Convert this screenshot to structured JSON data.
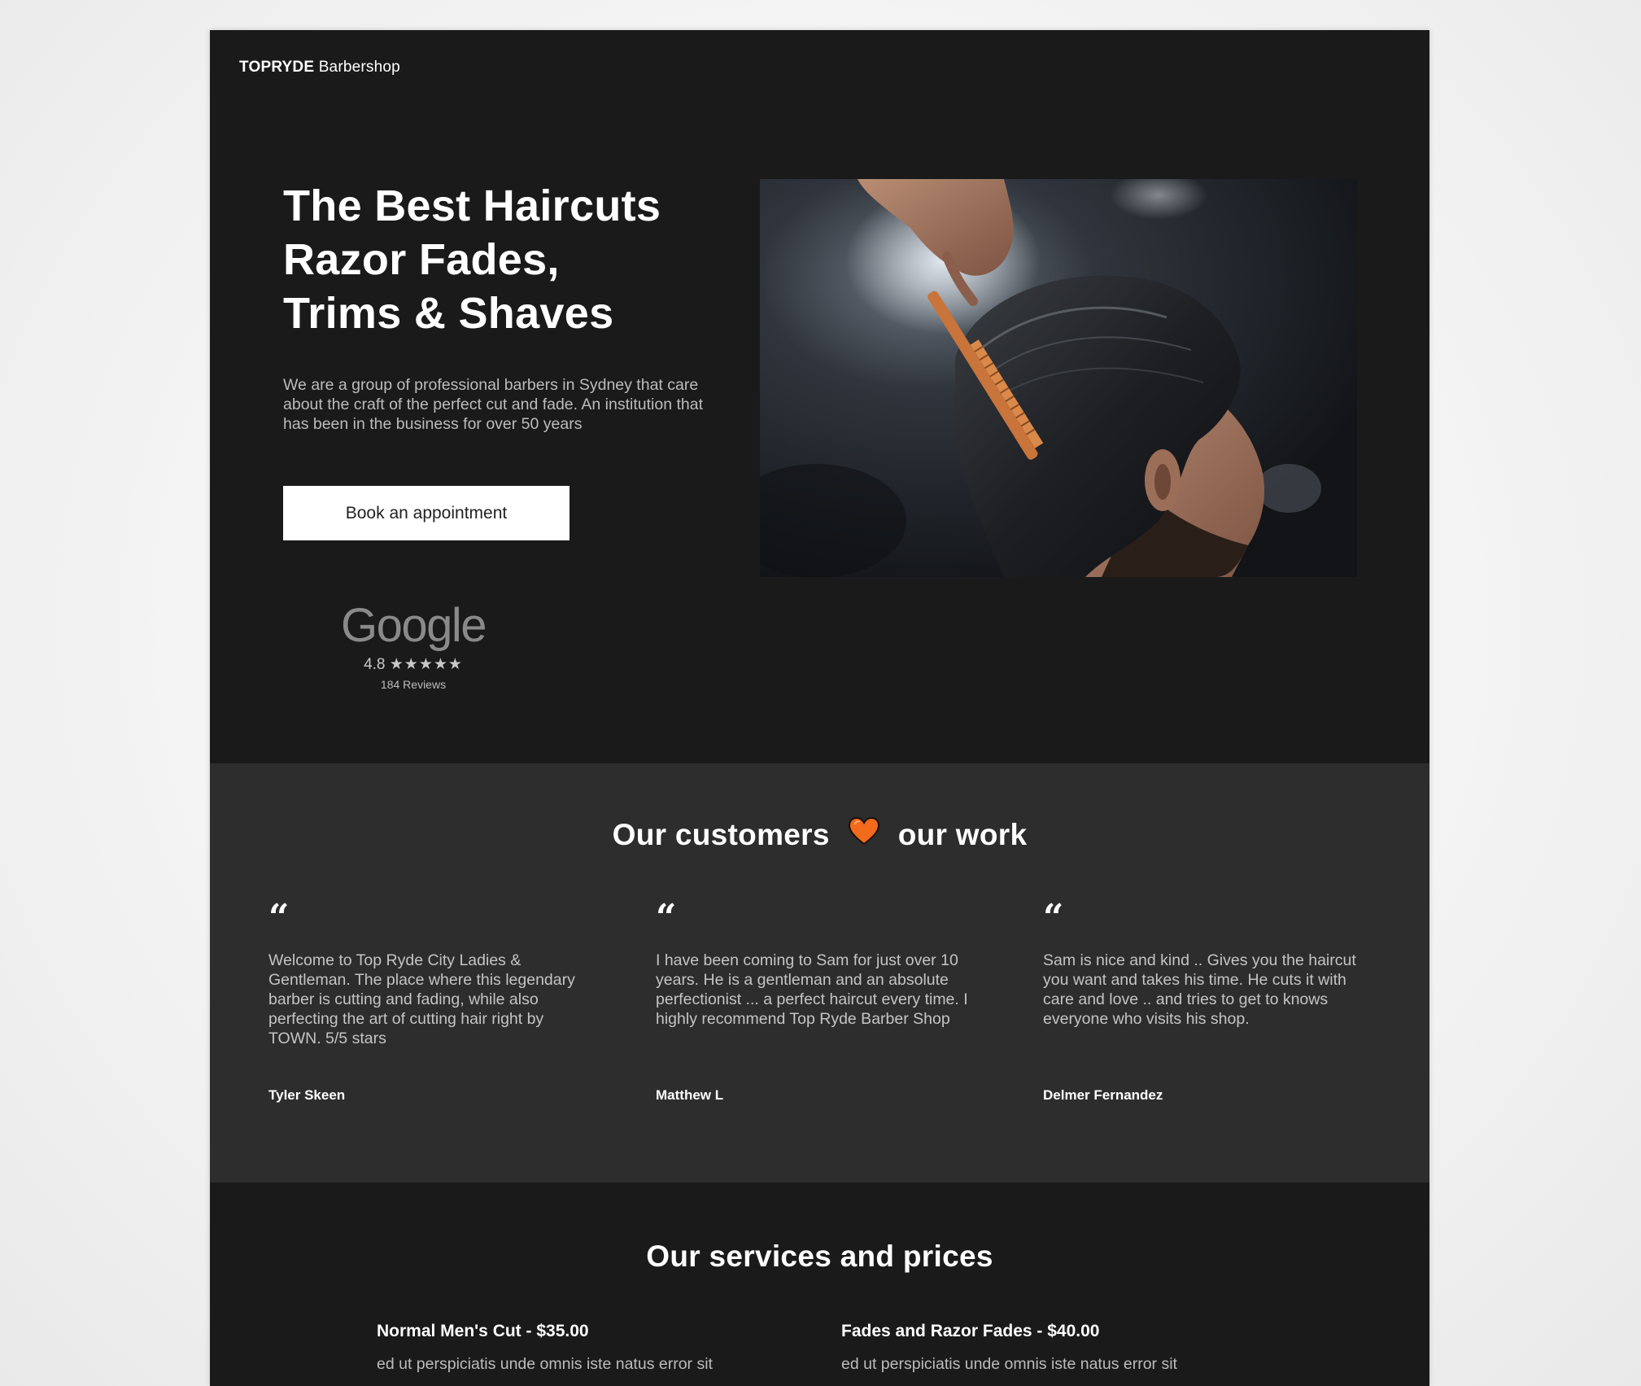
{
  "header": {
    "brand_bold": "TOPRYDE",
    "brand_rest": "Barbershop"
  },
  "hero": {
    "title_lines": [
      "The Best Haircuts",
      "Razor Fades,",
      "Trims & Shaves"
    ],
    "description": "We are a group of professional barbers in Sydney that care about the craft of the perfect cut and fade. An institution that has been in the business for over 50 years",
    "cta_label": "Book an appointment",
    "image_icon": "barber-combing-hair-photo"
  },
  "google": {
    "logo_text": "Google",
    "rating": "4.8",
    "stars": "★★★★★",
    "reviews": "184 Reviews"
  },
  "testimonials": {
    "title_left": "Our customers",
    "title_right": "our work",
    "heart_icon": "heart-icon",
    "heart_color": "#f26a1b",
    "quote_glyph": "“",
    "items": [
      {
        "text": "Welcome to Top Ryde City Ladies & Gentleman. The place where this legendary barber is cutting and fading, while also perfecting the art of cutting hair right by TOWN. 5/5 stars",
        "author": "Tyler Skeen"
      },
      {
        "text": "I have been coming to Sam for just over 10 years. He is a gentleman and an absolute perfectionist ... a perfect haircut every time. I highly recommend Top Ryde Barber Shop",
        "author": "Matthew L"
      },
      {
        "text": "Sam is nice and kind .. Gives you the haircut you want and takes his time. He cuts it with care and love .. and tries to get to knows everyone who visits his shop.",
        "author": "Delmer Fernandez"
      }
    ]
  },
  "services": {
    "title": "Our services and prices",
    "items": [
      {
        "name": "Normal Men's Cut - $35.00",
        "description": "ed ut perspiciatis unde omnis iste natus error sit"
      },
      {
        "name": "Fades and Razor Fades - $40.00",
        "description": "ed ut perspiciatis unde omnis iste natus error sit"
      }
    ]
  },
  "colors": {
    "hero_bg": "#1b1a1b",
    "testimonials_bg": "#2d2d2e",
    "accent": "#f26a1b"
  }
}
